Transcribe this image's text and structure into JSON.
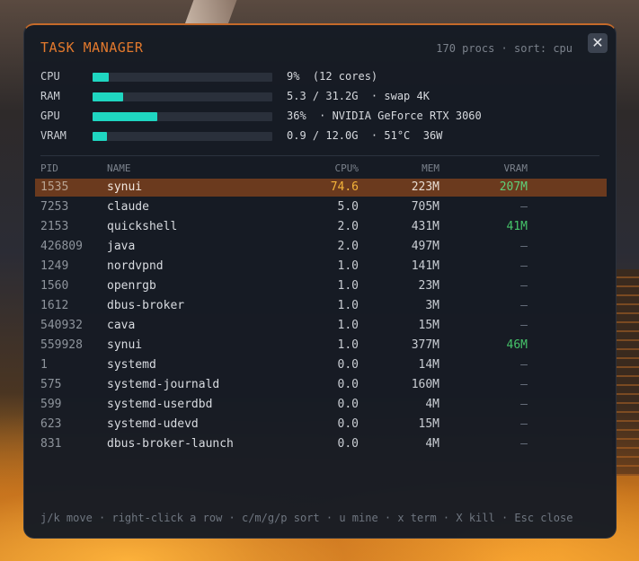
{
  "colors": {
    "accent": "#e2792d",
    "bar_fill": "#1fd6c1",
    "selected_row": "#6b3a1e",
    "vram_value": "#46c46a",
    "cpu_selected": "#f4b43a"
  },
  "header": {
    "title": "TASK MANAGER",
    "summary": "170 procs · sort: cpu",
    "close_icon": "✕"
  },
  "resources": [
    {
      "label": "CPU",
      "percent": 9,
      "text": "9%  (12 cores)"
    },
    {
      "label": "RAM",
      "percent": 17,
      "text": "5.3 / 31.2G  · swap 4K"
    },
    {
      "label": "GPU",
      "percent": 36,
      "text": "36%  · NVIDIA GeForce RTX 3060"
    },
    {
      "label": "VRAM",
      "percent": 8,
      "text": "0.9 / 12.0G  · 51°C  36W"
    }
  ],
  "table": {
    "headers": {
      "pid": "PID",
      "name": "NAME",
      "cpu": "CPU%",
      "mem": "MEM",
      "vram": "VRAM"
    },
    "selected_index": 0,
    "rows": [
      {
        "pid": "1535",
        "name": "synui",
        "cpu": "74.6",
        "mem": "223M",
        "vram": "207M"
      },
      {
        "pid": "7253",
        "name": "claude",
        "cpu": "5.0",
        "mem": "705M",
        "vram": "–"
      },
      {
        "pid": "2153",
        "name": "quickshell",
        "cpu": "2.0",
        "mem": "431M",
        "vram": "41M"
      },
      {
        "pid": "426809",
        "name": "java",
        "cpu": "2.0",
        "mem": "497M",
        "vram": "–"
      },
      {
        "pid": "1249",
        "name": "nordvpnd",
        "cpu": "1.0",
        "mem": "141M",
        "vram": "–"
      },
      {
        "pid": "1560",
        "name": "openrgb",
        "cpu": "1.0",
        "mem": "23M",
        "vram": "–"
      },
      {
        "pid": "1612",
        "name": "dbus-broker",
        "cpu": "1.0",
        "mem": "3M",
        "vram": "–"
      },
      {
        "pid": "540932",
        "name": "cava",
        "cpu": "1.0",
        "mem": "15M",
        "vram": "–"
      },
      {
        "pid": "559928",
        "name": "synui",
        "cpu": "1.0",
        "mem": "377M",
        "vram": "46M"
      },
      {
        "pid": "1",
        "name": "systemd",
        "cpu": "0.0",
        "mem": "14M",
        "vram": "–"
      },
      {
        "pid": "575",
        "name": "systemd-journald",
        "cpu": "0.0",
        "mem": "160M",
        "vram": "–"
      },
      {
        "pid": "599",
        "name": "systemd-userdbd",
        "cpu": "0.0",
        "mem": "4M",
        "vram": "–"
      },
      {
        "pid": "623",
        "name": "systemd-udevd",
        "cpu": "0.0",
        "mem": "15M",
        "vram": "–"
      },
      {
        "pid": "831",
        "name": "dbus-broker-launch",
        "cpu": "0.0",
        "mem": "4M",
        "vram": "–"
      }
    ]
  },
  "footer": {
    "hints": "j/k move · right-click a row · c/m/g/p sort · u mine · x term · X kill · Esc close"
  }
}
